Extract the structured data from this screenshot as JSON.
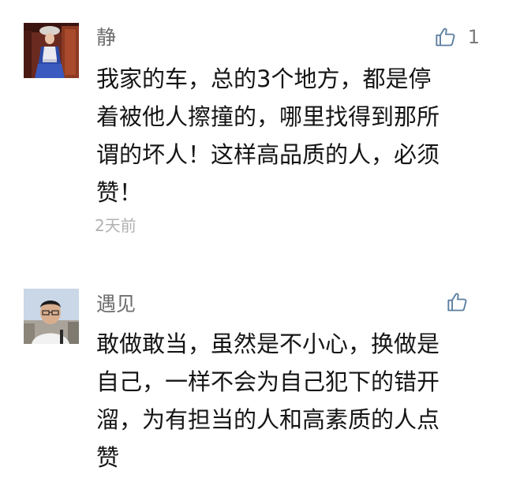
{
  "comments": [
    {
      "author": "静",
      "likes": "1",
      "lines": [
        "我家的车，总的3个地方，都是停",
        "着被他人擦撞的，哪里找得到那所",
        "谓的坏人！这样高品质的人，必须",
        "赞！"
      ],
      "time": "2天前",
      "avatar_icon": "avatar-woman-in-costume",
      "like_icon": "thumbs-up-icon"
    },
    {
      "author": "遇见",
      "likes": "",
      "lines": [
        "敢做敢当，虽然是不小心，换做是",
        "自己，一样不会为自己犯下的错开",
        "溜，为有担当的人和高素质的人点",
        "赞"
      ],
      "avatar_icon": "avatar-man-with-glasses",
      "like_icon": "thumbs-up-icon"
    }
  ],
  "colors": {
    "name": "#6d6d6d",
    "like_icon": "#5b7ea0",
    "time": "#b1b1b1",
    "text": "#151515"
  }
}
